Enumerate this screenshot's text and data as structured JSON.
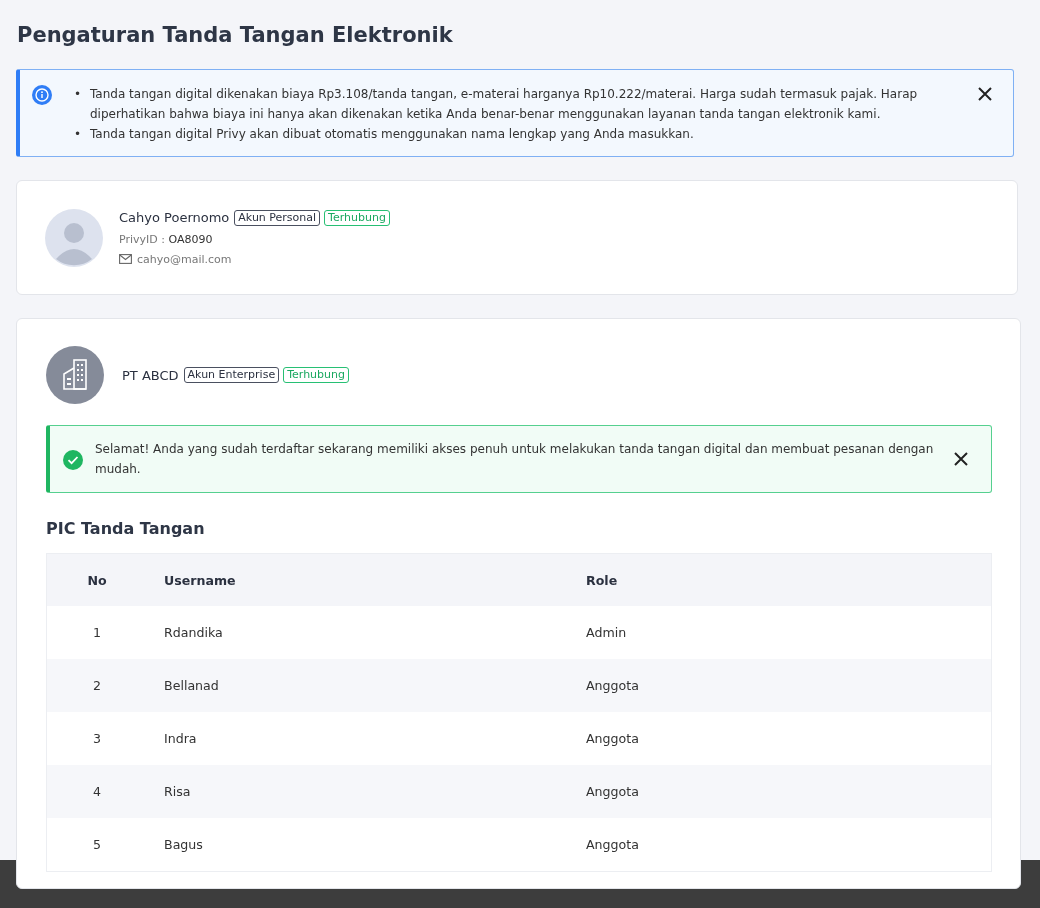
{
  "page_title": "Pengaturan Tanda Tangan Elektronik",
  "info_alert": {
    "items": [
      {
        "bullet": "•",
        "text": "Tanda tangan digital dikenakan biaya Rp3.108/tanda tangan, e-materai harganya Rp10.222/materai. Harga sudah termasuk pajak. Harap diperhatikan bahwa biaya ini hanya akan dikenakan ketika Anda benar-benar menggunakan layanan tanda tangan elektronik kami."
      },
      {
        "bullet": "•",
        "text": "Tanda tangan digital Privy akan dibuat otomatis menggunakan nama lengkap yang Anda masukkan."
      }
    ]
  },
  "personal": {
    "name": "Cahyo Poernomo",
    "account_badge": "Akun Personal",
    "status_badge": "Terhubung",
    "privy_label": "PrivyID : ",
    "privy_id": "OA8090",
    "email": "cahyo@mail.com"
  },
  "enterprise": {
    "name": "PT ABCD",
    "account_badge": "Akun Enterprise",
    "status_badge": "Terhubung",
    "success_alert": "Selamat! Anda yang sudah terdaftar sekarang memiliki akses penuh untuk melakukan tanda tangan digital dan membuat pesanan dengan mudah.",
    "section_title": "PIC Tanda Tangan",
    "table": {
      "columns": [
        "No",
        "Username",
        "Role"
      ],
      "rows": [
        [
          "1",
          "Rdandika",
          "Admin"
        ],
        [
          "2",
          "Bellanad",
          "Anggota"
        ],
        [
          "3",
          "Indra",
          "Anggota"
        ],
        [
          "4",
          "Risa",
          "Anggota"
        ],
        [
          "5",
          "Bagus",
          "Anggota"
        ]
      ]
    }
  }
}
